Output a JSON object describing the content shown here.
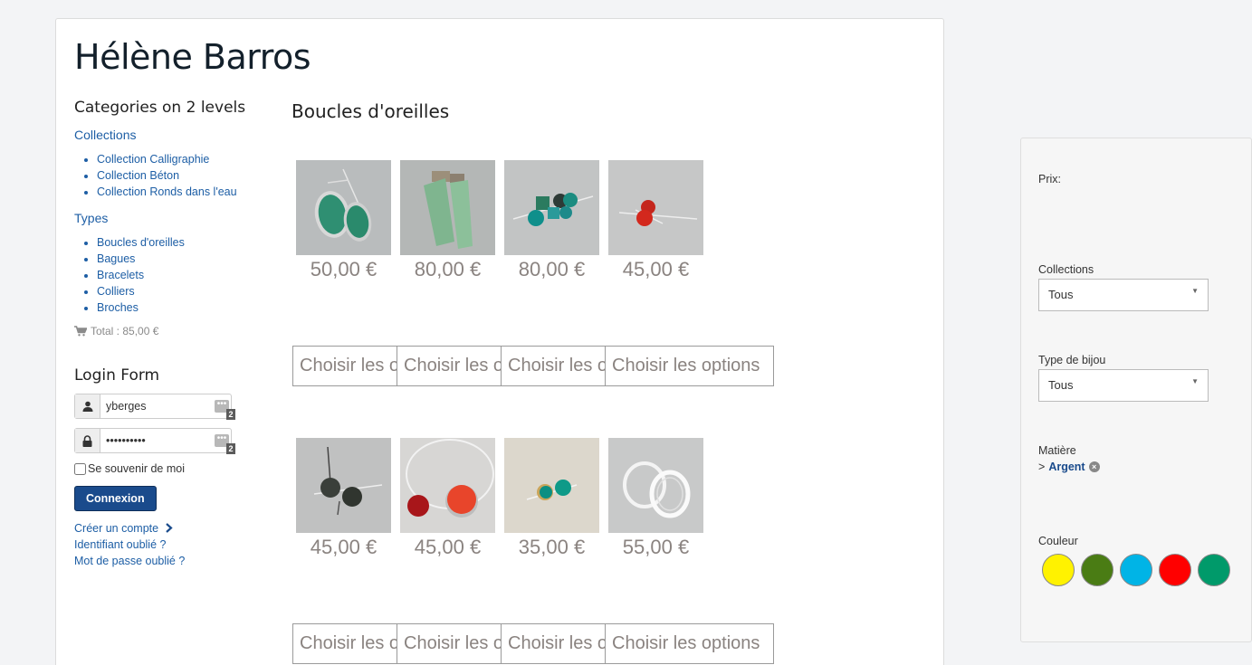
{
  "site": {
    "title": "Hélène Barros"
  },
  "sidebar": {
    "categories_title": "Categories on 2 levels",
    "collections": {
      "heading": "Collections",
      "items": [
        "Collection Calligraphie",
        "Collection Béton",
        "Collection Ronds dans l'eau"
      ]
    },
    "types": {
      "heading": "Types",
      "items": [
        "Boucles d'oreilles",
        "Bagues",
        "Bracelets",
        "Colliers",
        "Broches"
      ]
    },
    "cart_total": "Total : 85,00 €"
  },
  "login": {
    "title": "Login Form",
    "username": "yberges",
    "password": "••••••••••",
    "manager_badge": "•••",
    "manager_count": "2",
    "remember": "Se souvenir de moi",
    "submit": "Connexion",
    "links": [
      "Créer un compte",
      "Identifiant oublié ?",
      "Mot de passe oublié ?"
    ]
  },
  "content": {
    "title": "Boucles d'oreilles",
    "option_label": "Choisir les options",
    "products": [
      {
        "price": "50,00 €",
        "image": "green-oval-earring"
      },
      {
        "price": "80,00 €",
        "image": "green-rectangle-earring"
      },
      {
        "price": "80,00 €",
        "image": "teal-round-earring-trio"
      },
      {
        "price": "45,00 €",
        "image": "red-dots-earring"
      },
      {
        "price": "45,00 €",
        "image": "grey-dots-earring"
      },
      {
        "price": "45,00 €",
        "image": "red-circle-necklace"
      },
      {
        "price": "35,00 €",
        "image": "teal-dots-earring"
      },
      {
        "price": "55,00 €",
        "image": "clear-ring-earring"
      }
    ]
  },
  "filters": {
    "price_label": "Prix:",
    "collections_label": "Collections",
    "collections_value": "Tous",
    "type_label": "Type de bijou",
    "type_value": "Tous",
    "matiere_label": "Matière",
    "matiere_prefix": ">",
    "matiere_value": "Argent",
    "couleur_label": "Couleur",
    "colors": [
      "#fff200",
      "#4a7c14",
      "#00b4e6",
      "#ff0000",
      "#009a6a"
    ]
  }
}
